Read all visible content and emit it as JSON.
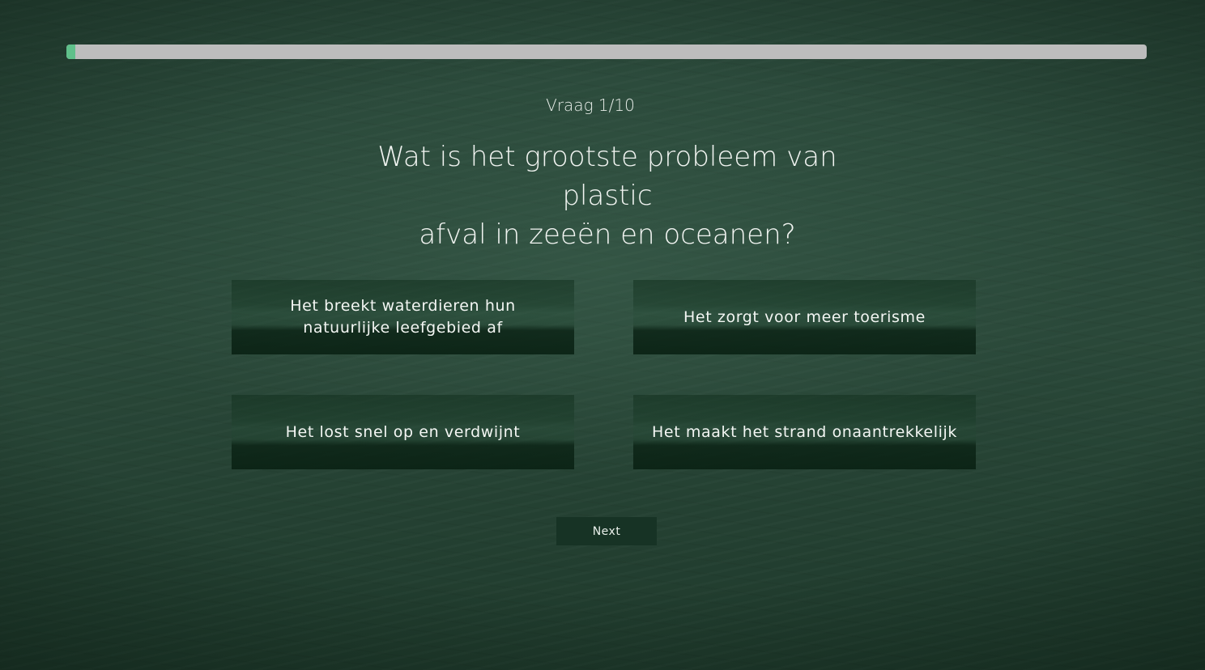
{
  "progress": {
    "fraction": 0.008,
    "fill_color": "#5fc08a",
    "track_color": "#bdbdbd"
  },
  "counter": "Vraag 1/10",
  "question": {
    "line1": "Wat is het grootste probleem van plastic",
    "line2": "afval in zeeën en oceanen?"
  },
  "answers": [
    {
      "label": "Het breekt waterdieren hun natuurlijke leefgebied af"
    },
    {
      "label": "Het zorgt voor meer toerisme"
    },
    {
      "label": "Het lost snel op en verdwijnt"
    },
    {
      "label": "Het maakt het strand onaantrekkelijk"
    }
  ],
  "next_label": "Next",
  "colors": {
    "background": "#284537",
    "button": "#173325"
  }
}
